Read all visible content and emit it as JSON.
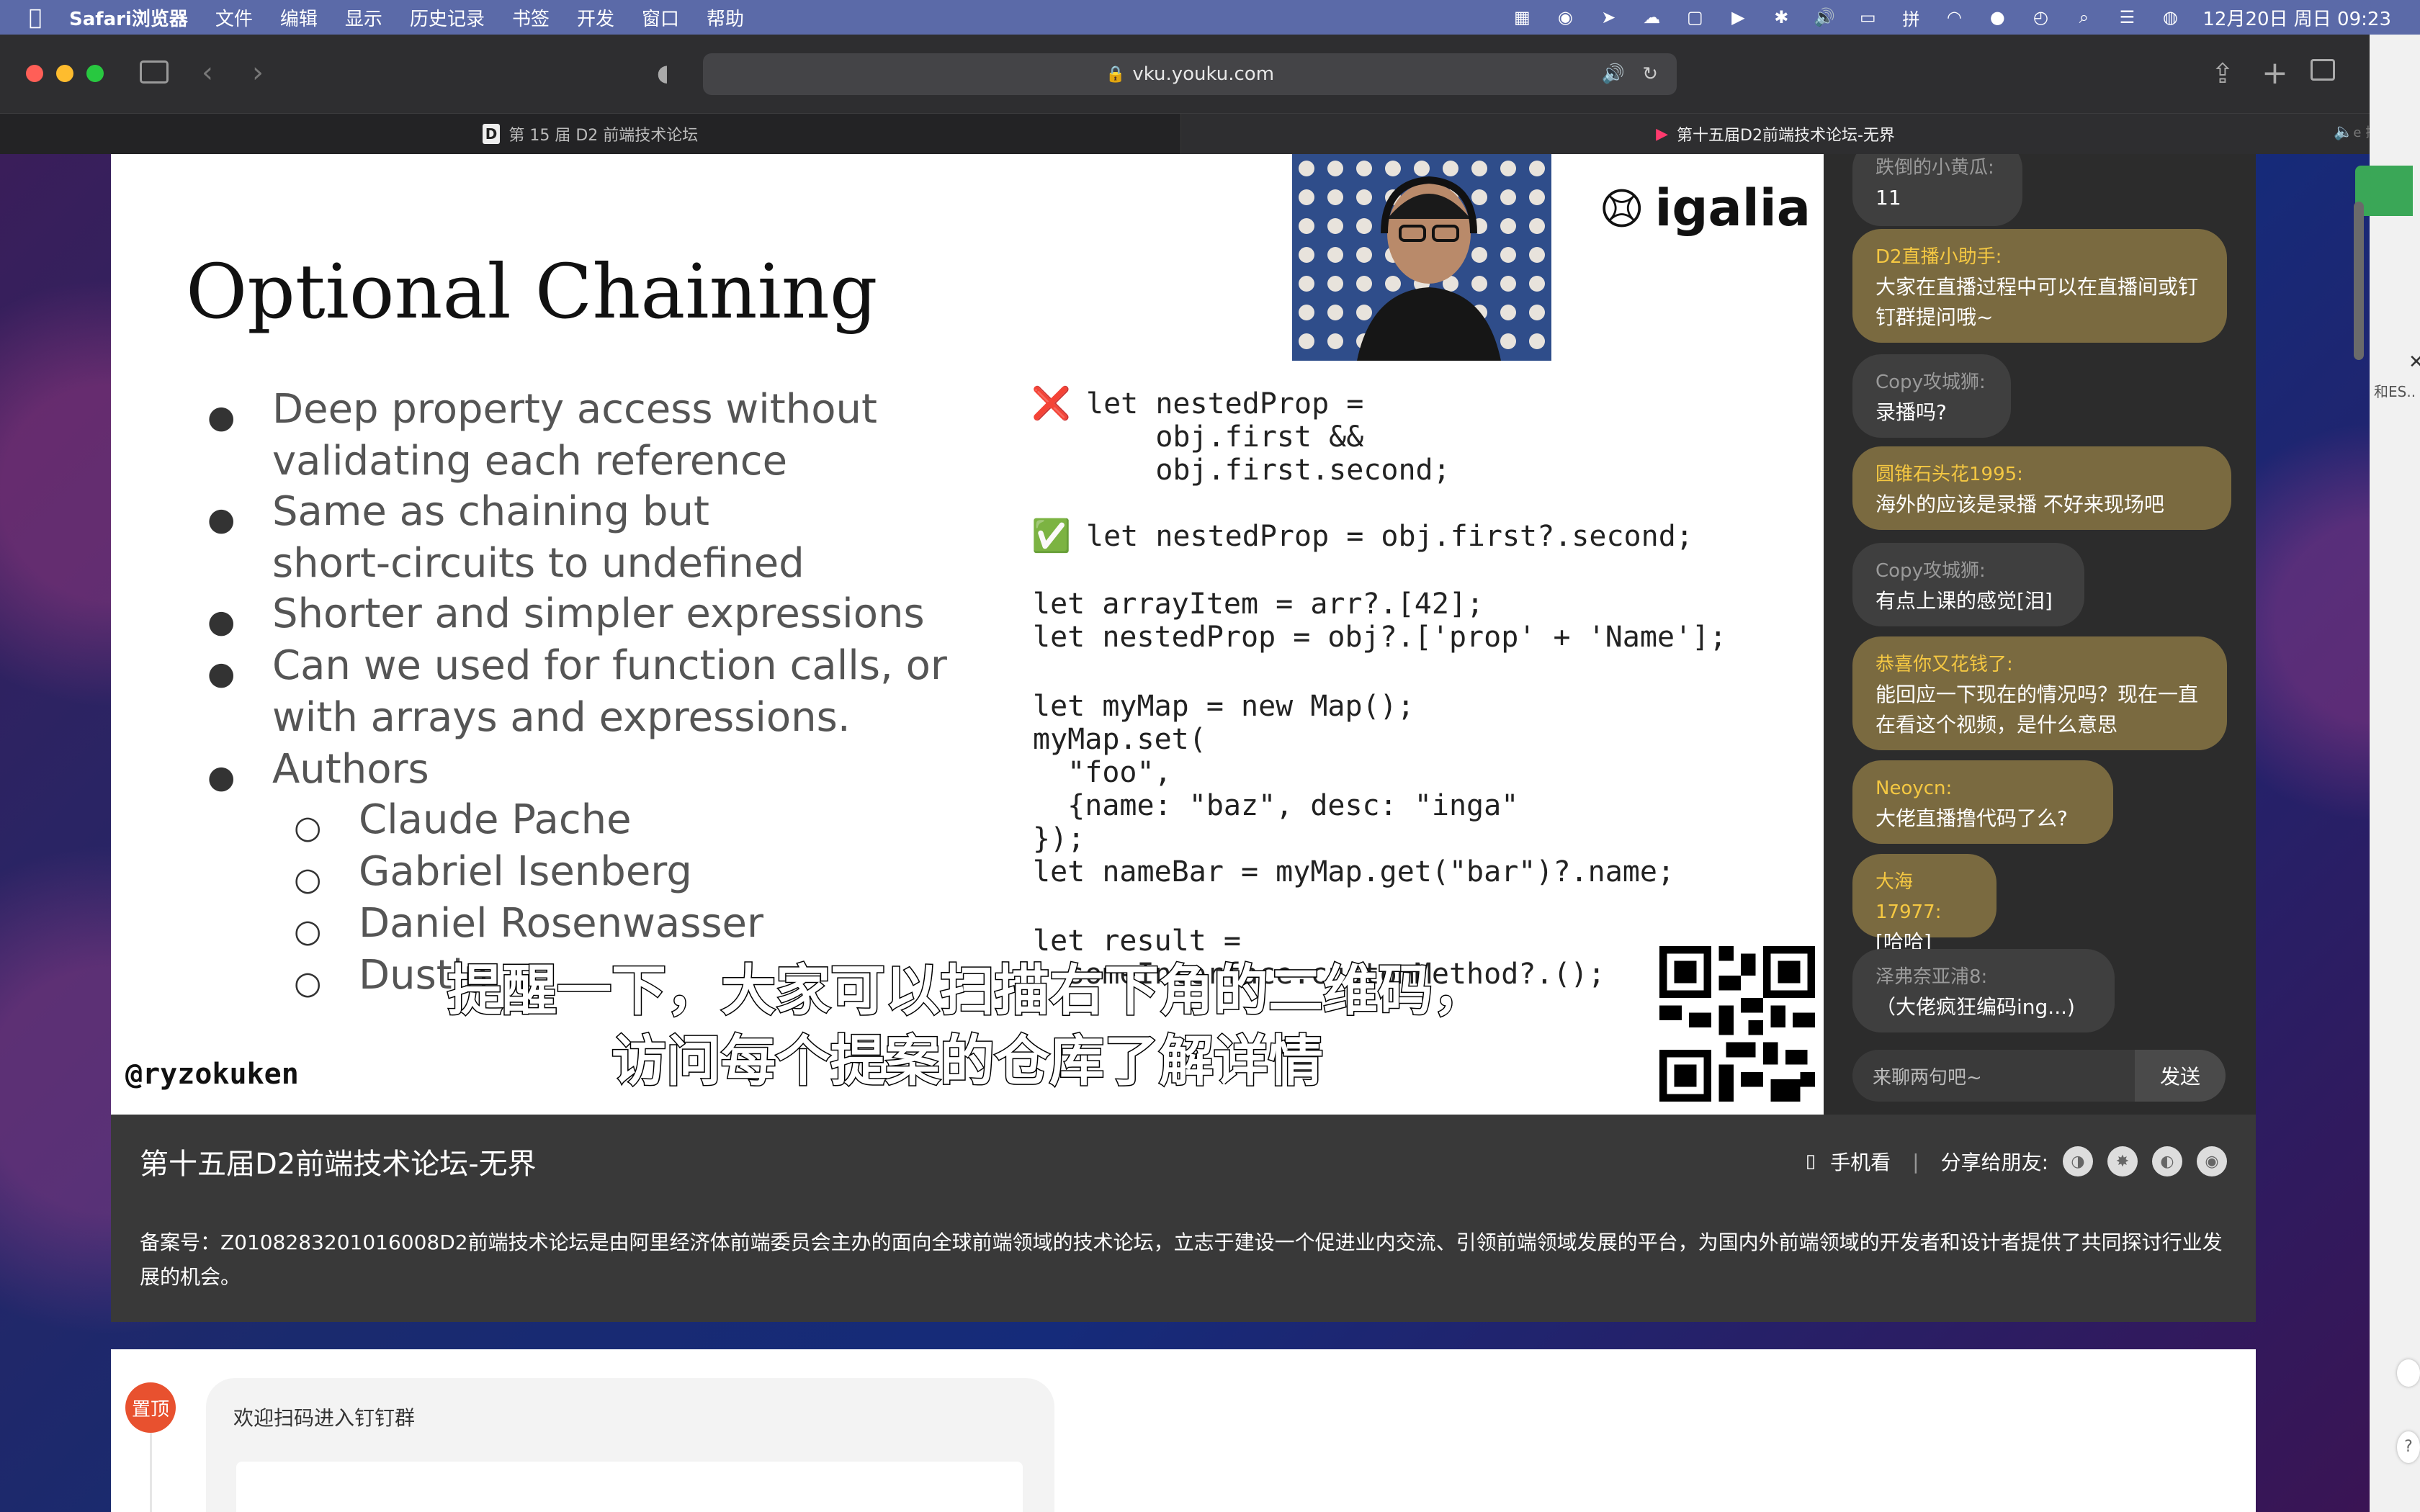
{
  "menubar": {
    "app": "Safari浏览器",
    "items": [
      "文件",
      "编辑",
      "显示",
      "历史记录",
      "书签",
      "开发",
      "窗口",
      "帮助"
    ],
    "clock": "12月20日 周日 09:23"
  },
  "browser": {
    "url": "vku.youku.com",
    "tabs": [
      {
        "label": "第 15 届 D2 前端技术论坛",
        "active": false
      },
      {
        "label": "第十五届D2前端技术论坛-无界",
        "active": true
      }
    ],
    "edge_text": "e 搜索",
    "edge_text2": "和ES.."
  },
  "slide": {
    "title": "Optional Chaining",
    "bullets": [
      [
        "Deep property access without",
        "validating each reference"
      ],
      [
        "Same as chaining but",
        "short-circuits to undefined"
      ],
      [
        "Shorter and simpler expressions"
      ],
      [
        "Can we used for function calls, or",
        "with arrays and expressions."
      ],
      [
        "Authors"
      ]
    ],
    "authors": [
      "Claude Pache",
      "Gabriel Isenberg",
      "Daniel Rosenwasser",
      "Dustin"
    ],
    "code": {
      "bad_marker": "❌",
      "good_marker": "✅",
      "bad_lines": [
        "let nestedProp =",
        "    obj.first &&",
        "    obj.first.second;"
      ],
      "good_line": "let nestedProp = obj.first?.second;",
      "lines": [
        "let arrayItem = arr?.[42];",
        "let nestedProp = obj?.['prop' + 'Name'];",
        "",
        "let myMap = new Map();",
        "myMap.set(",
        "  \"foo\",",
        "  {name: \"baz\", desc: \"inga\"",
        "});",
        "let nameBar = myMap.get(\"bar\")?.name;",
        "",
        "let result =",
        "  someInterface.customMethod?.();"
      ]
    },
    "logo_text": "igalia",
    "handle": "@ryzokuken",
    "subtitle_line1": "提醒一下，大家可以扫描右下角的二维码，",
    "subtitle_line2": "访问每个提案的仓库了解详情"
  },
  "chat": {
    "messages": [
      {
        "name": "跌倒的小黄瓜:",
        "text": "11",
        "style": "gray"
      },
      {
        "name": "D2直播小助手:",
        "text": "大家在直播过程中可以在直播间或钉钉群提问哦~",
        "style": "gold"
      },
      {
        "name": "Copy攻城狮:",
        "text": "录播吗?",
        "style": "gray"
      },
      {
        "name": "圆锥石头花1995:",
        "text": "海外的应该是录播 不好来现场吧",
        "style": "gold"
      },
      {
        "name": "Copy攻城狮:",
        "text": "有点上课的感觉[泪]",
        "style": "gray"
      },
      {
        "name": "恭喜你又花钱了:",
        "text": "能回应一下现在的情况吗？现在一直在看这个视频，是什么意思",
        "style": "gold"
      },
      {
        "name": "Neoycn:",
        "text": "大佬直播撸代码了么?",
        "style": "gold"
      },
      {
        "name": "大海17977:",
        "text": "[哈哈]",
        "style": "gold"
      },
      {
        "name": "泽弗奈亚浦8:",
        "text": "（大佬疯狂编码ing...)",
        "style": "gray"
      }
    ],
    "input_placeholder": "来聊两句吧~",
    "send_label": "发送"
  },
  "info": {
    "title": "第十五届D2前端技术论坛-无界",
    "mobile_label": "手机看",
    "separator": "|",
    "share_label": "分享给朋友:",
    "description": "备案号：Z0108283201016008D2前端技术论坛是由阿里经济体前端委员会主办的面向全球前端领域的技术论坛，立志于建设一个促进业内交流、引领前端领域发展的平台，为国内外前端领域的开发者和设计者提供了共同探讨行业发展的机会。"
  },
  "comments": {
    "pin_label": "置顶",
    "card_text": "欢迎扫码进入钉钉群"
  },
  "colors": {
    "menubar": "#5b6aa8",
    "chat_gold": "#7a6a40",
    "chat_name_gold": "#f5c842",
    "pin": "#e8512f"
  }
}
